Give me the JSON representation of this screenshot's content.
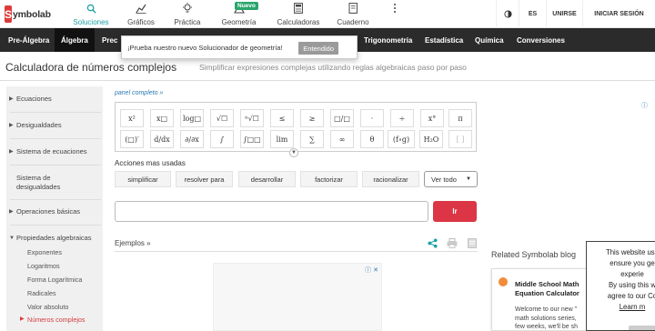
{
  "logo": {
    "initial": "S",
    "text": "ymbolab"
  },
  "nav": [
    {
      "label": "Soluciones",
      "icon": "search-icon"
    },
    {
      "label": "Gráficos",
      "icon": "chart-icon"
    },
    {
      "label": "Práctica",
      "icon": "lightbulb-icon"
    },
    {
      "label": "Geometría",
      "icon": "geometry-icon",
      "badge": "Nuevo"
    },
    {
      "label": "Calculadoras",
      "icon": "calculator-icon"
    },
    {
      "label": "Cuaderno",
      "icon": "notebook-icon"
    }
  ],
  "right_nav": {
    "lang": "ES",
    "join": "UNIRSE",
    "login": "INICIAR SESIÓN"
  },
  "subjects": [
    "Pre-Álgebra",
    "Álgebra",
    "Prec",
    "Trigonometría",
    "Estadística",
    "Química",
    "Conversiones"
  ],
  "popup": {
    "text": "¡Prueba nuestro nuevo Solucionador de geometría!",
    "button": "Entendido"
  },
  "page": {
    "title": "Calculadora de números complejos",
    "subtitle": "Simplificar expresiones complejas utilizando reglas algebraicas paso por paso"
  },
  "sidebar": {
    "items": [
      "Ecuaciones",
      "Desigualdades",
      "Sistema de ecuaciones",
      "Sistema de desigualdades",
      "Operaciones básicas",
      "Propiedades algebraicas"
    ],
    "sub_items": [
      "Exponentes",
      "Logaritmos",
      "Forma Logarítmica",
      "Radicales",
      "Valor absoluto",
      "Números complejos"
    ]
  },
  "panel_link": "panel completo »",
  "keypad": [
    [
      "x²",
      "x□",
      "log□",
      "√☐",
      "ⁿ√☐",
      "≤",
      "≥",
      "□/□",
      "·",
      "÷",
      "x°",
      "π"
    ],
    [
      "(□)′",
      "d/dx",
      "∂/∂x",
      "∫",
      "∫□□",
      "lim",
      "∑",
      "∞",
      "θ",
      "(f∘g)",
      "H₂O",
      "[ ]"
    ]
  ],
  "actions": {
    "label": "Acciones mas usadas",
    "buttons": [
      "simplificar",
      "resolver para",
      "desarrollar",
      "factorizar",
      "racionalizar"
    ],
    "more": "Ver todo"
  },
  "go_button": "Ir",
  "examples_label": "Ejemplos »",
  "related_title": "Related Symbolab blog",
  "blog_card": {
    "title_line1": "Middle School Math",
    "title_line2": "Equation Calculator",
    "body_line1": "Welcome to our new \"",
    "body_line2": "math solutions series,",
    "body_line3": "few weeks, we'll be sh"
  },
  "cookie": {
    "line1": "This website use",
    "line2": "ensure you ge",
    "line3": "experie",
    "line4": "By using this w",
    "line5": "agree to our Co",
    "link": "Learn m"
  },
  "ad_marker": "ⓘ",
  "ad_close": "✕"
}
